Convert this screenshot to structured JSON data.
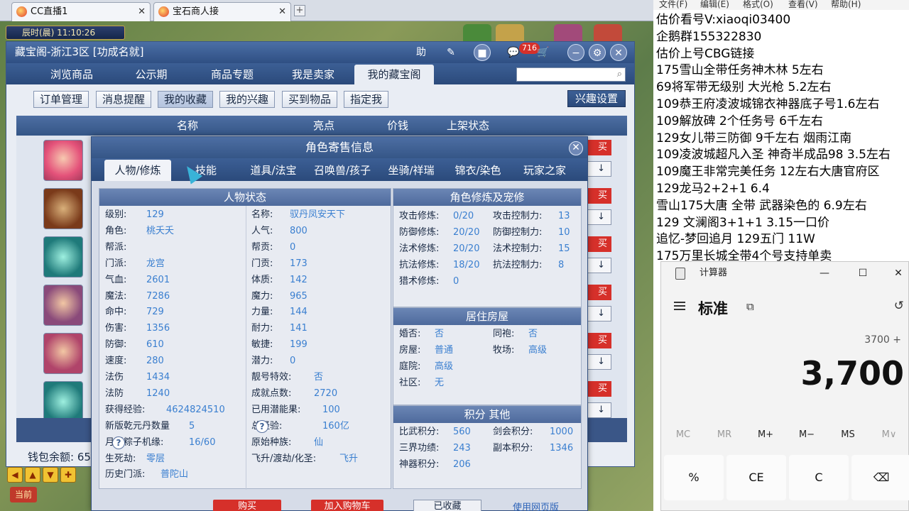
{
  "browser": {
    "tabs": [
      {
        "label": "CC直播1"
      },
      {
        "label": "宝石商人接"
      }
    ],
    "new_tab_symbol": "+",
    "close_symbol": "✕"
  },
  "scene": {
    "clock": "辰时(晨) 11:10:26",
    "bottom_buttons": [
      "◀",
      "▲",
      "▼",
      "✚"
    ],
    "dangqian": "当前"
  },
  "cbg": {
    "title": "藏宝阁-浙江3区 [功成名就]",
    "title_buttons": {
      "help": "助",
      "message_badge": "716"
    },
    "nav": [
      "浏览商品",
      "公示期",
      "商品专题",
      "我是卖家",
      "我的藏宝阁"
    ],
    "active_nav": "我的藏宝阁",
    "subnav": [
      "订单管理",
      "消息提醒",
      "我的收藏",
      "我的兴趣",
      "买到物品",
      "指定我"
    ],
    "active_subnav": "我的收藏",
    "interest_settings": "兴趣设置",
    "columns": [
      "名称",
      "亮点",
      "价钱",
      "上架状态"
    ],
    "buy_label": "买",
    "down_arrow": "↓",
    "wallet": "钱包余额: 65"
  },
  "dialog": {
    "title": "角色寄售信息",
    "tabs": [
      "人物/修炼",
      "技能",
      "道具/法宝",
      "召唤兽/孩子",
      "坐骑/祥瑞",
      "锦衣/染色",
      "玩家之家"
    ],
    "active_tab": "人物/修炼",
    "status_panel": {
      "header": "人物状态",
      "left": [
        {
          "label": "级别:",
          "value": "129"
        },
        {
          "label": "角色:",
          "value": "桃夭夭"
        },
        {
          "label": "帮派:",
          "value": ""
        },
        {
          "label": "门派:",
          "value": "龙宫"
        },
        {
          "label": "气血:",
          "value": "2601"
        },
        {
          "label": "魔法:",
          "value": "7286"
        },
        {
          "label": "命中:",
          "value": "729"
        },
        {
          "label": "伤害:",
          "value": "1356"
        },
        {
          "label": "防御:",
          "value": "610"
        },
        {
          "label": "速度:",
          "value": "280"
        },
        {
          "label": "法伤",
          "value": "1434"
        },
        {
          "label": "法防",
          "value": "1240"
        },
        {
          "label": "获得经验:",
          "value": "4624824510"
        },
        {
          "label": "新版乾元丹数量",
          "value": "5"
        },
        {
          "label": "月饼粽子机缘:",
          "value": "16/60"
        },
        {
          "label": "生死劫:",
          "value": "零层"
        },
        {
          "label": "历史门派:",
          "value": "普陀山"
        }
      ],
      "right": [
        {
          "label": "名称:",
          "value": "驭丹凤安天下"
        },
        {
          "label": "人气:",
          "value": "800"
        },
        {
          "label": "帮贡:",
          "value": "0"
        },
        {
          "label": "门贡:",
          "value": "173"
        },
        {
          "label": "体质:",
          "value": "142"
        },
        {
          "label": "魔力:",
          "value": "965"
        },
        {
          "label": "力量:",
          "value": "144"
        },
        {
          "label": "耐力:",
          "value": "141"
        },
        {
          "label": "敏捷:",
          "value": "199"
        },
        {
          "label": "潜力:",
          "value": "0"
        },
        {
          "label": "靓号特效:",
          "value": "否"
        },
        {
          "label": "成就点数:",
          "value": "2720"
        },
        {
          "label": "已用潜能果:",
          "value": "100"
        },
        {
          "label": "总经验:",
          "value": "160亿"
        },
        {
          "label": "原始种族:",
          "value": "仙"
        },
        {
          "label": "飞升/渡劫/化圣:",
          "value": "飞升"
        }
      ],
      "help_symbol": "?"
    },
    "cultivation_panel": {
      "header": "角色修炼及宠修",
      "left": [
        {
          "label": "攻击修炼:",
          "value": "0/20"
        },
        {
          "label": "防御修炼:",
          "value": "20/20"
        },
        {
          "label": "法术修炼:",
          "value": "20/20"
        },
        {
          "label": "抗法修炼:",
          "value": "18/20"
        },
        {
          "label": "猎术修炼:",
          "value": "0"
        }
      ],
      "right": [
        {
          "label": "攻击控制力:",
          "value": "13"
        },
        {
          "label": "防御控制力:",
          "value": "10"
        },
        {
          "label": "法术控制力:",
          "value": "15"
        },
        {
          "label": "抗法控制力:",
          "value": "8"
        }
      ]
    },
    "house_panel": {
      "header": "居住房屋",
      "left": [
        {
          "label": "婚否:",
          "value": "否"
        },
        {
          "label": "房屋:",
          "value": "普通"
        },
        {
          "label": "庭院:",
          "value": "高级"
        },
        {
          "label": "社区:",
          "value": "无"
        }
      ],
      "right": [
        {
          "label": "同袍:",
          "value": "否"
        },
        {
          "label": "牧场:",
          "value": "高级"
        }
      ]
    },
    "score_panel": {
      "header": "积分 其他",
      "left": [
        {
          "label": "比武积分:",
          "value": "560"
        },
        {
          "label": "三界功绩:",
          "value": "243"
        },
        {
          "label": "神器积分:",
          "value": "206"
        }
      ],
      "right": [
        {
          "label": "剑会积分:",
          "value": "1000"
        },
        {
          "label": "副本积分:",
          "value": "1346"
        }
      ]
    },
    "bottom": {
      "buy": "购买",
      "add_cart": "加入购物车",
      "collected": "已收藏",
      "use_web": "使用网页版"
    }
  },
  "notes": {
    "menu": [
      "文件(F)",
      "编辑(E)",
      "格式(O)",
      "查看(V)",
      "帮助(H)"
    ],
    "lines": [
      "估价看号V:xiaoqi03400",
      "企鹅群155322830",
      "估价上号CBG链接",
      "175雪山全带任务神木林 5左右",
      "69将军带无级别 大光枪 5.2左右",
      "109恭王府凌波城锦衣神器底子号1.6左右",
      "109解放碑 2个任务号 6千左右",
      "129女儿带三防御 9千左右 烟雨江南",
      "109凌波城超凡入圣 神奇半成品98 3.5左右",
      "109魔王非常完美任务 12左右大唐官府区",
      "129龙马2+2+1  6.4",
      "雪山175大唐 全带 武器染色的 6.9左右",
      "129 文澜阁3+1+1   3.15一口价",
      "追忆-梦回追月 129五门 11W",
      "175万里长城全带4个号支持单卖"
    ]
  },
  "calculator": {
    "title": "计算器",
    "mode": "标准",
    "expression": "3700 +",
    "display": "3,700",
    "memory": [
      "MC",
      "MR",
      "M+",
      "M−",
      "MS",
      "M∨"
    ],
    "keys": [
      "%",
      "CE",
      "C",
      "⌫"
    ],
    "window_controls": [
      "—",
      "☐",
      "✕"
    ]
  }
}
